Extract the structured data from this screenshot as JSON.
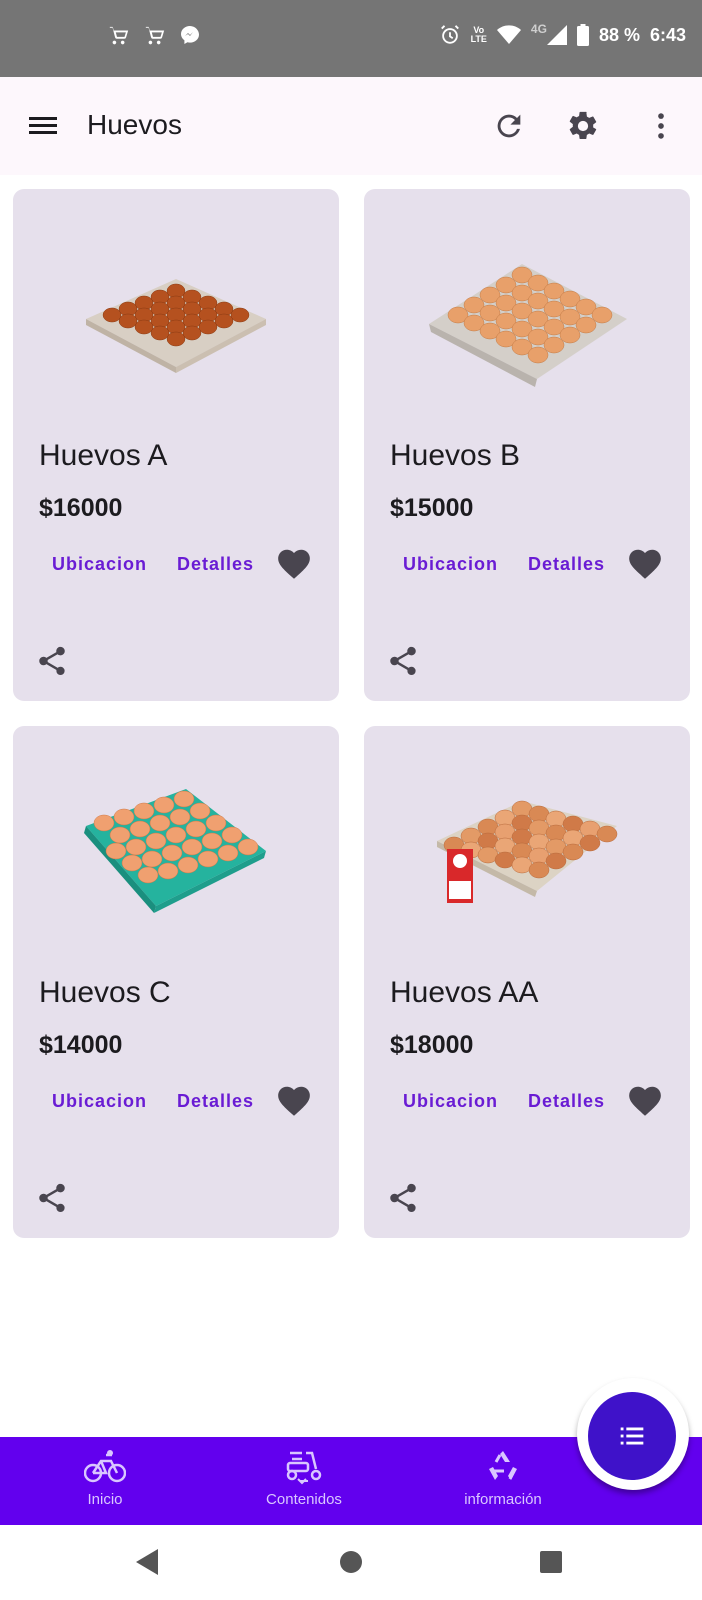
{
  "status_bar": {
    "battery": "88 %",
    "time": "6:43",
    "network": "4G",
    "volte_top": "Vo",
    "volte_bottom": "LTE",
    "icons_left": [
      "shopping-cart-icon",
      "shopping-cart-icon",
      "messenger-icon"
    ],
    "icons_right": [
      "alarm-icon",
      "volte-icon",
      "wifi-icon",
      "signal-icon",
      "battery-icon"
    ]
  },
  "app_bar": {
    "title": "Huevos",
    "icons": [
      "menu-icon",
      "refresh-icon",
      "settings-icon",
      "more-vert-icon"
    ]
  },
  "products": [
    {
      "name": "Huevos A",
      "price": "$16000",
      "location_label": "Ubicacion",
      "details_label": "Detalles",
      "tray": "brown",
      "eggs": "dark-brown"
    },
    {
      "name": "Huevos B",
      "price": "$15000",
      "location_label": "Ubicacion",
      "details_label": "Detalles",
      "tray": "gray",
      "eggs": "light-brown"
    },
    {
      "name": "Huevos C",
      "price": "$14000",
      "location_label": "Ubicacion",
      "details_label": "Detalles",
      "tray": "teal",
      "eggs": "light-brown"
    },
    {
      "name": "Huevos AA",
      "price": "$18000",
      "location_label": "Ubicacion",
      "details_label": "Detalles",
      "tray": "beige",
      "eggs": "mixed-brown",
      "has_sticker": true
    }
  ],
  "bottom_nav": {
    "items": [
      {
        "label": "Inicio",
        "icon": "bicycle-icon"
      },
      {
        "label": "Contenidos",
        "icon": "scooter-icon"
      },
      {
        "label": "información",
        "icon": "recycle-icon"
      }
    ],
    "fab_icon": "list-icon"
  },
  "colors": {
    "accent": "#6200ee",
    "button_text": "#6a1cd4",
    "card_bg": "#e6e0ec",
    "status_bar": "#757575",
    "fab": "#3f12c9"
  }
}
